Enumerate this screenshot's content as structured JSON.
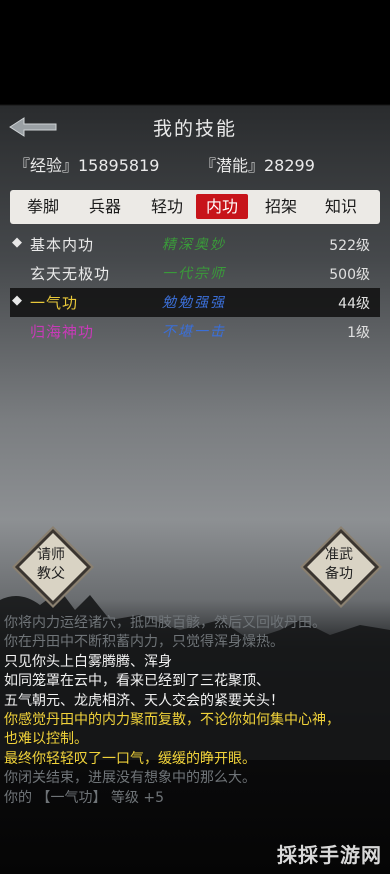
{
  "header": {
    "title": "我的技能",
    "back_icon": "back-arrow-icon"
  },
  "stats": {
    "exp": "『经验』15895819",
    "potential": "『潜能』28299"
  },
  "tabs": [
    {
      "label": "拳脚"
    },
    {
      "label": "兵器"
    },
    {
      "label": "轻功"
    },
    {
      "label": "内功",
      "active": true
    },
    {
      "label": "招架"
    },
    {
      "label": "知识"
    }
  ],
  "skills": [
    {
      "marker": "◆",
      "name": "基本内功",
      "rank": "精深奥妙",
      "level": "522级",
      "name_color": "#eaeaea",
      "rank_color": "#3a9a3a"
    },
    {
      "marker": "",
      "name": "玄天无极功",
      "rank": "一代宗师",
      "level": "500级",
      "name_color": "#eaeaea",
      "rank_color": "#3a9a3a"
    },
    {
      "marker": "◆",
      "name": "一气功",
      "rank": "勉勉强强",
      "level": "44级",
      "name_color": "#e8c83a",
      "rank_color": "#3b6fd8",
      "selected": true
    },
    {
      "marker": "",
      "name": "归海神功",
      "rank": "不堪一击",
      "level": "1级",
      "name_color": "#c83ab8",
      "rank_color": "#3b6fd8"
    }
  ],
  "buttons": {
    "ask_master": "请师\n教父",
    "prepare": "准武\n备功"
  },
  "log": [
    {
      "text": "你将内力运经诸穴，抵四肢百骸，然后又回收丹田。",
      "color": "#6f7478"
    },
    {
      "text": "你在丹田中不断积蓄内力，只觉得浑身燥热。",
      "color": "#6f7478"
    },
    {
      "text": "只见你头上白雾腾腾、浑身",
      "color": "#f2f2f2"
    },
    {
      "text": "如同笼罩在云中，看来已经到了三花聚顶、",
      "color": "#f2f2f2"
    },
    {
      "text": "五气朝元、龙虎相济、天人交会的紧要关头！",
      "color": "#f2f2f2"
    },
    {
      "text": "你感觉丹田中的内力聚而复散，不论你如何集中心神，",
      "color": "#f0d23a"
    },
    {
      "text": "也难以控制。",
      "color": "#f0d23a"
    },
    {
      "text": "最终你轻轻叹了一口气，缓缓的睁开眼。",
      "color": "#f0d23a"
    },
    {
      "text": "你闭关结束，进展没有想象中的那么大。",
      "color": "#6f7478"
    },
    {
      "text": "你的 【一气功】 等级 +5",
      "color": "#6f7478"
    }
  ],
  "watermark": "採採手游网"
}
